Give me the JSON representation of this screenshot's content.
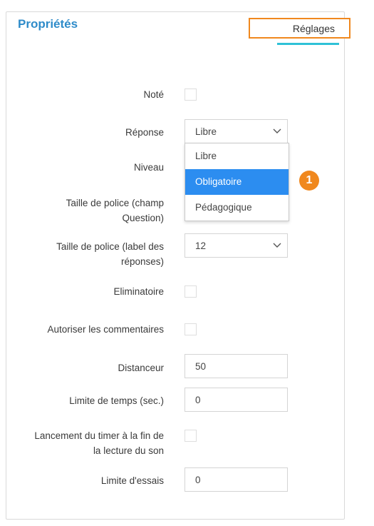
{
  "panel": {
    "title": "Propriétés",
    "tab_label": "Réglages"
  },
  "form": {
    "note_label": "Noté",
    "reponse_label": "Réponse",
    "reponse_value": "Libre",
    "reponse_options": [
      "Libre",
      "Obligatoire",
      "Pédagogique"
    ],
    "reponse_highlighted": "Obligatoire",
    "niveau_label": "Niveau",
    "taille_question_label_1": "Taille de police (champ",
    "taille_question_label_2": "Question)",
    "taille_reponses_label_1": "Taille de police (label des",
    "taille_reponses_label_2": "réponses)",
    "taille_reponses_value": "12",
    "eliminatoire_label": "Eliminatoire",
    "commentaires_label": "Autoriser les commentaires",
    "distanceur_label": "Distanceur",
    "distanceur_value": "50",
    "limite_temps_label": "Limite de temps (sec.)",
    "limite_temps_value": "0",
    "timer_label_1": "Lancement du timer à la fin de",
    "timer_label_2": "la lecture du son",
    "limite_essais_label": "Limite d'essais",
    "limite_essais_value": "0"
  },
  "annotation": {
    "badge_number": "1",
    "badge_color": "#f0881e"
  },
  "colors": {
    "title": "#2e8bc9",
    "tab_border": "#f0881e",
    "tab_underline": "#2fc1d7",
    "selected_option": "#2c8df0"
  }
}
